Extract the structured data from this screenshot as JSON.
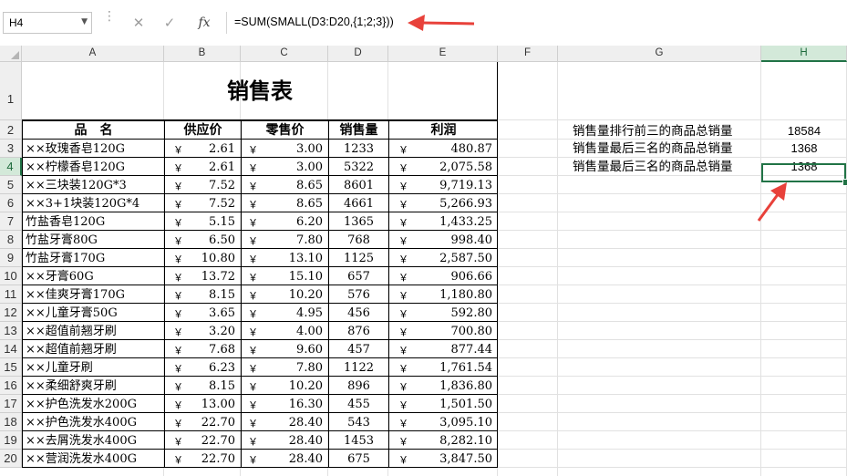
{
  "name_box": "H4",
  "formula": "=SUM(SMALL(D3:D20,{1;2;3}))",
  "formula_buttons": {
    "cancel": "✕",
    "enter": "✓",
    "fx": "fx"
  },
  "columns": [
    "A",
    "B",
    "C",
    "D",
    "E",
    "F",
    "G",
    "H"
  ],
  "selected_column": "H",
  "selected_row": "4",
  "rows": [
    "1",
    "2",
    "3",
    "4",
    "5",
    "6",
    "7",
    "8",
    "9",
    "10",
    "11",
    "12",
    "13",
    "14",
    "15",
    "16",
    "17",
    "18",
    "19",
    "20"
  ],
  "title": "销售表",
  "headers": {
    "name": "品　名",
    "supply": "供应价",
    "retail": "零售价",
    "volume": "销售量",
    "profit": "利润"
  },
  "currency": "￥",
  "products": [
    {
      "name": "××玫瑰香皂120G",
      "supply": "2.61",
      "retail": "3.00",
      "volume": "1233",
      "profit": "480.87"
    },
    {
      "name": "××柠檬香皂120G",
      "supply": "2.61",
      "retail": "3.00",
      "volume": "5322",
      "profit": "2,075.58"
    },
    {
      "name": "××三块装120G*3",
      "supply": "7.52",
      "retail": "8.65",
      "volume": "8601",
      "profit": "9,719.13"
    },
    {
      "name": "××3+1块装120G*4",
      "supply": "7.52",
      "retail": "8.65",
      "volume": "4661",
      "profit": "5,266.93"
    },
    {
      "name": "竹盐香皂120G",
      "supply": "5.15",
      "retail": "6.20",
      "volume": "1365",
      "profit": "1,433.25"
    },
    {
      "name": "竹盐牙膏80G",
      "supply": "6.50",
      "retail": "7.80",
      "volume": "768",
      "profit": "998.40"
    },
    {
      "name": "竹盐牙膏170G",
      "supply": "10.80",
      "retail": "13.10",
      "volume": "1125",
      "profit": "2,587.50"
    },
    {
      "name": "××牙膏60G",
      "supply": "13.72",
      "retail": "15.10",
      "volume": "657",
      "profit": "906.66"
    },
    {
      "name": "××佳爽牙膏170G",
      "supply": "8.15",
      "retail": "10.20",
      "volume": "576",
      "profit": "1,180.80"
    },
    {
      "name": "××儿童牙膏50G",
      "supply": "3.65",
      "retail": "4.95",
      "volume": "456",
      "profit": "592.80"
    },
    {
      "name": "××超值前翘牙刷",
      "supply": "3.20",
      "retail": "4.00",
      "volume": "876",
      "profit": "700.80"
    },
    {
      "name": "××超值前翘牙刷",
      "supply": "7.68",
      "retail": "9.60",
      "volume": "457",
      "profit": "877.44"
    },
    {
      "name": "××儿童牙刷",
      "supply": "6.23",
      "retail": "7.80",
      "volume": "1122",
      "profit": "1,761.54"
    },
    {
      "name": "××柔细舒爽牙刷",
      "supply": "8.15",
      "retail": "10.20",
      "volume": "896",
      "profit": "1,836.80"
    },
    {
      "name": "××护色洗发水200G",
      "supply": "13.00",
      "retail": "16.30",
      "volume": "455",
      "profit": "1,501.50"
    },
    {
      "name": "××护色洗发水400G",
      "supply": "22.70",
      "retail": "28.40",
      "volume": "543",
      "profit": "3,095.10"
    },
    {
      "name": "××去屑洗发水400G",
      "supply": "22.70",
      "retail": "28.40",
      "volume": "1453",
      "profit": "8,282.10"
    },
    {
      "name": "××营润洗发水400G",
      "supply": "22.70",
      "retail": "28.40",
      "volume": "675",
      "profit": "3,847.50"
    }
  ],
  "summary": [
    {
      "label": "销售量排行前三的商品总销量",
      "value": "18584"
    },
    {
      "label": "销售量最后三名的商品总销量",
      "value": "1368"
    },
    {
      "label": "销售量最后三名的商品总销量",
      "value": "1368"
    }
  ],
  "annotation_color": "#e8413a",
  "accent_color": "#217346"
}
